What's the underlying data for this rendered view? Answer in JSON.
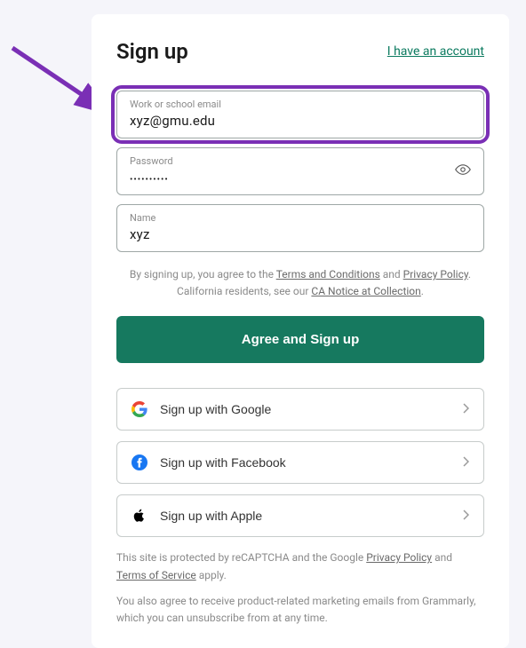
{
  "header": {
    "title": "Sign up",
    "account_link": "I have an account"
  },
  "fields": {
    "email": {
      "label": "Work or school email",
      "value": "xyz@gmu.edu"
    },
    "password": {
      "label": "Password",
      "value": "••••••••••"
    },
    "name": {
      "label": "Name",
      "value": "xyz"
    }
  },
  "legal": {
    "pre": "By signing up, you agree to the ",
    "terms": "Terms and Conditions",
    "and": " and ",
    "privacy": "Privacy Policy",
    "period": ".",
    "ca_pre": "California residents, see our ",
    "ca_link": "CA Notice at Collection",
    "ca_period": "."
  },
  "primary_button": "Agree and Sign up",
  "social": {
    "google": "Sign up with Google",
    "facebook": "Sign up with Facebook",
    "apple": "Sign up with Apple"
  },
  "recaptcha": {
    "pre": "This site is protected by reCAPTCHA and the Google ",
    "privacy": "Privacy Policy",
    "and": " and ",
    "tos": "Terms of Service",
    "post": " apply."
  },
  "marketing": "You also agree to receive product-related marketing emails from Grammarly, which you can unsubscribe from at any time."
}
